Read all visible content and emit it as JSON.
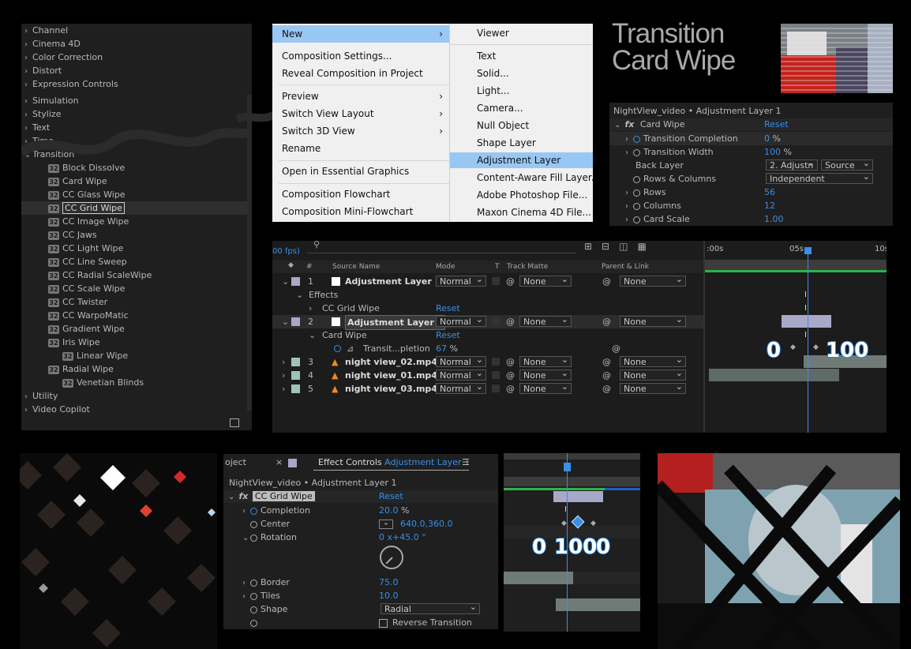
{
  "effects_panel": {
    "categories_top": [
      "Channel",
      "Cinema 4D",
      "Color Correction",
      "Distort",
      "Expression Controls",
      "Simulation",
      "Stylize",
      "Text",
      "Time"
    ],
    "transition_label": "Transition",
    "transitions": [
      "Block Dissolve",
      "Card Wipe",
      "CC Glass Wipe",
      "CC Grid Wipe",
      "CC Image Wipe",
      "CC Jaws",
      "CC Light Wipe",
      "CC Line Sweep",
      "CC Radial ScaleWipe",
      "CC Scale Wipe",
      "CC Twister",
      "CC WarpoMatic",
      "Gradient Wipe",
      "Iris Wipe",
      "Linear Wipe",
      "Radial Wipe",
      "Venetian Blinds"
    ],
    "selected": "CC Grid Wipe",
    "categories_bottom": [
      "Utility",
      "Video Copilot"
    ]
  },
  "context_menu": {
    "left": [
      "New",
      "Composition Settings...",
      "Reveal Composition in Project",
      "Preview",
      "Switch View Layout",
      "Switch 3D View",
      "Rename",
      "Open in Essential Graphics",
      "Composition Flowchart",
      "Composition Mini-Flowchart"
    ],
    "submenu": [
      "Viewer",
      "Text",
      "Solid...",
      "Light...",
      "Camera...",
      "Null Object",
      "Shape Layer",
      "Adjustment Layer",
      "Content-Aware Fill Layer...",
      "Adobe Photoshop File...",
      "Maxon Cinema 4D File..."
    ]
  },
  "title": {
    "line1": "Transition",
    "line2": "Card Wipe"
  },
  "card_wipe_panel": {
    "header": "NightView_video • Adjustment Layer 1",
    "fx_name": "Card Wipe",
    "reset": "Reset",
    "props": [
      {
        "name": "Transition Completion",
        "value": "0",
        "unit": "%"
      },
      {
        "name": "Transition Width",
        "value": "100",
        "unit": "%"
      },
      {
        "name": "Back Layer",
        "value": "2. Adjustn",
        "value2": "Source"
      },
      {
        "name": "Rows & Columns",
        "value": "Independent"
      },
      {
        "name": "Rows",
        "value": "56"
      },
      {
        "name": "Columns",
        "value": "12"
      },
      {
        "name": "Card Scale",
        "value": "1.00"
      }
    ]
  },
  "timeline": {
    "fps": "00 fps)",
    "columns": {
      "num": "#",
      "source": "Source Name",
      "mode": "Mode",
      "t": "T",
      "matte": "Track Matte",
      "parent": "Parent & Link"
    },
    "ticks": [
      ":00s",
      "05s",
      "10s"
    ],
    "layers": [
      {
        "num": "1",
        "name": "Adjustment Layer 1",
        "mode": "Normal",
        "matte": "None",
        "parent": "None"
      },
      {
        "num": "2",
        "name": "Adjustment Layer 1",
        "mode": "Normal",
        "matte": "None",
        "parent": "None"
      },
      {
        "num": "3",
        "name": "night view_02.mp4",
        "mode": "Normal",
        "matte": "None",
        "parent": "None"
      },
      {
        "num": "4",
        "name": "night view_01.mp4",
        "mode": "Normal",
        "matte": "None",
        "parent": "None"
      },
      {
        "num": "5",
        "name": "night view_03.mp4",
        "mode": "Normal",
        "matte": "None",
        "parent": "None"
      }
    ],
    "effects_label": "Effects",
    "cc_grid_wipe": "CC Grid Wipe",
    "card_wipe": "Card Wipe",
    "reset": "Reset",
    "transit_prop": "Transit...pletion",
    "transit_value": "67",
    "transit_unit": "%",
    "kf_labels": [
      "0",
      "100"
    ]
  },
  "effect_controls": {
    "tab_prev": "oject",
    "tab_label": "Effect Controls",
    "tab_layer": "Adjustment Layer 1",
    "header": "NightView_video • Adjustment Layer 1",
    "fx_name": "CC Grid Wipe",
    "reset": "Reset",
    "completion": {
      "name": "Completion",
      "value": "20.0",
      "unit": "%"
    },
    "center": {
      "name": "Center",
      "value": "640.0,360.0"
    },
    "rotation": {
      "name": "Rotation",
      "value": "0 x+45.0 °"
    },
    "border": {
      "name": "Border",
      "value": "75.0"
    },
    "tiles": {
      "name": "Tiles",
      "value": "10.0"
    },
    "shape": {
      "name": "Shape",
      "value": "Radial"
    },
    "reverse": "Reverse Transition"
  },
  "mini_timeline": {
    "kf_labels": [
      "0",
      "100",
      "0"
    ]
  },
  "colors": {
    "accent": "#3a8fe6",
    "menu_highlight": "#99c7f3",
    "timeline_bar": "#a8a8c8"
  }
}
